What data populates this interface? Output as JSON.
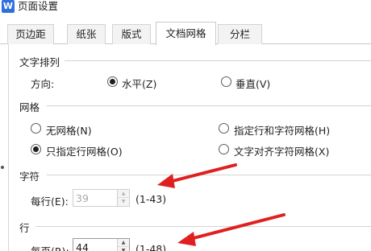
{
  "window": {
    "app_icon_letter": "W",
    "title": "页面设置"
  },
  "tabs": [
    {
      "label": "页边距",
      "active": false
    },
    {
      "label": "纸张",
      "active": false
    },
    {
      "label": "版式",
      "active": false
    },
    {
      "label": "文档网格",
      "active": true
    },
    {
      "label": "分栏",
      "active": false
    }
  ],
  "text_direction": {
    "section_title": "文字排列",
    "direction_label": "方向:",
    "options": [
      {
        "label": "水平(Z)",
        "checked": true
      },
      {
        "label": "垂直(V)",
        "checked": false
      }
    ]
  },
  "grid": {
    "section_title": "网格",
    "options": [
      {
        "label": "无网格(N)",
        "checked": false
      },
      {
        "label": "指定行和字符网格(H)",
        "checked": false
      },
      {
        "label": "只指定行网格(O)",
        "checked": true
      },
      {
        "label": "文字对齐字符网格(X)",
        "checked": false
      }
    ]
  },
  "characters": {
    "section_title": "字符",
    "per_line_label": "每行(E):",
    "per_line_value": "39",
    "per_line_range": "(1-43)",
    "enabled": false
  },
  "lines": {
    "section_title": "行",
    "per_page_label": "每页(R):",
    "per_page_value": "44",
    "per_page_range": "(1-48)",
    "enabled": true
  },
  "annotation": {
    "arrow_color": "#e02020"
  }
}
